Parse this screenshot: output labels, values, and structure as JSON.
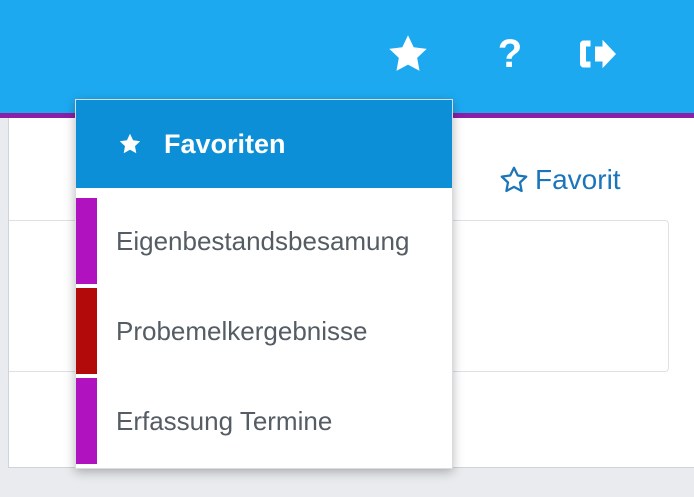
{
  "topbar": {
    "background": "#1da9f0",
    "accent_border": "#8b1fa8",
    "icons": [
      "star-icon",
      "help-icon",
      "sign-out-icon"
    ],
    "help_glyph": "?"
  },
  "main": {
    "favorit_button_label": "Favorit",
    "favorit_icon": "star-outline-icon",
    "accent_color": "#1b75bb"
  },
  "dropdown": {
    "header_label": "Favoriten",
    "header_icon": "star-icon",
    "header_color": "#0c8fd6",
    "items": [
      {
        "label": "Eigenbestandsbesamung",
        "color": "#b012c0"
      },
      {
        "label": "Probemelkergebnisse",
        "color": "#b20a0a"
      },
      {
        "label": "Erfassung Termine",
        "color": "#b012c0"
      }
    ]
  }
}
